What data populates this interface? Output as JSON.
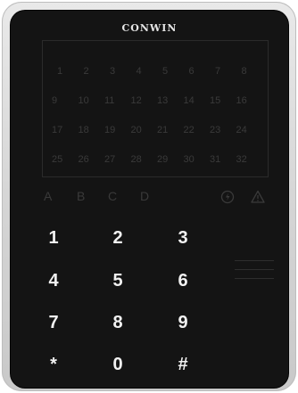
{
  "brand": "CONWIN",
  "zones": [
    "1",
    "2",
    "3",
    "4",
    "5",
    "6",
    "7",
    "8",
    "9",
    "10",
    "11",
    "12",
    "13",
    "14",
    "15",
    "16",
    "17",
    "18",
    "19",
    "20",
    "21",
    "22",
    "23",
    "24",
    "25",
    "26",
    "27",
    "28",
    "29",
    "30",
    "31",
    "32"
  ],
  "status_letters": [
    "A",
    "B",
    "C",
    "D"
  ],
  "status_icons": [
    "power-icon",
    "warning-icon"
  ],
  "keys": [
    "1",
    "2",
    "3",
    "4",
    "5",
    "6",
    "7",
    "8",
    "9",
    "*",
    "0",
    "#"
  ],
  "colors": {
    "face": "#141414",
    "shell": "#d9d9d9",
    "key_text": "#f2f2f2",
    "dim_text": "#3a3a3a"
  }
}
